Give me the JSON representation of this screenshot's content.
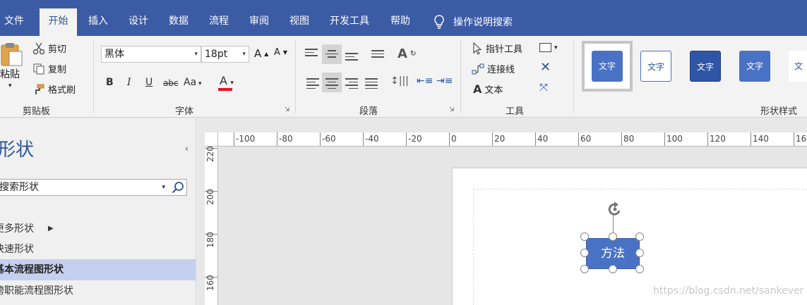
{
  "tabs": [
    {
      "label": "文件"
    },
    {
      "label": "开始"
    },
    {
      "label": "插入"
    },
    {
      "label": "设计"
    },
    {
      "label": "数据"
    },
    {
      "label": "流程"
    },
    {
      "label": "审阅"
    },
    {
      "label": "视图"
    },
    {
      "label": "开发工具"
    },
    {
      "label": "帮助"
    }
  ],
  "tell_me": "操作说明搜索",
  "clipboard": {
    "paste": "粘贴",
    "cut": "剪切",
    "copy": "复制",
    "format_painter": "格式刷",
    "label": "剪贴板"
  },
  "font": {
    "family": "黑体",
    "size": "18pt",
    "bold": "B",
    "italic": "I",
    "underline": "U",
    "strike": "abc",
    "case": "Aa",
    "color_letter": "A",
    "grow": "A",
    "shrink": "A",
    "label": "字体",
    "color_hex": "#e81123"
  },
  "paragraph": {
    "label": "段落"
  },
  "tools": {
    "pointer": "指针工具",
    "connector": "连接线",
    "text": "文本",
    "label": "工具"
  },
  "shape_styles": {
    "label": "形状样式",
    "items": [
      {
        "text": "文字"
      },
      {
        "text": "文字"
      },
      {
        "text": "文字"
      },
      {
        "text": "文字"
      },
      {
        "text": "文字"
      }
    ]
  },
  "shapes_pane": {
    "title": "形状",
    "collapse": "‹",
    "search_value": "搜索形状",
    "items": [
      {
        "label": "更多形状"
      },
      {
        "label": "快速形状"
      },
      {
        "label": "基本流程图形状"
      },
      {
        "label": "跨职能流程图形状"
      }
    ]
  },
  "rulers": {
    "horizontal": [
      "-100",
      "-80",
      "-60",
      "-40",
      "-20",
      "0",
      "20",
      "40",
      "60",
      "80",
      "100",
      "120",
      "140",
      "16"
    ],
    "vertical": [
      "220",
      "200",
      "180",
      "160"
    ]
  },
  "canvas": {
    "shape_text": "方法",
    "watermark": "https://blog.csdn.net/sankever"
  },
  "colors": {
    "ribbon_blue": "#3b5ba5",
    "shape_fill": "#4a72c4",
    "selection": "#c5d0f0"
  }
}
